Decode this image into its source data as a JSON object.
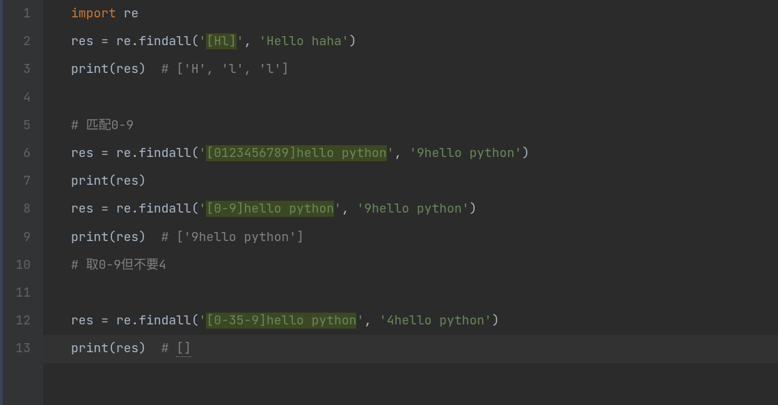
{
  "gutter": [
    "1",
    "2",
    "3",
    "4",
    "5",
    "6",
    "7",
    "8",
    "9",
    "10",
    "11",
    "12",
    "13"
  ],
  "code": {
    "l1": {
      "import": "import",
      "mod": " re"
    },
    "l2": {
      "a": "res ",
      "b": "=",
      "c": " re.findall(",
      "d": "'",
      "e": "[Hl]",
      "f": "'",
      "g": ", ",
      "h": "'Hello haha'",
      "i": ")"
    },
    "l3": {
      "a": "print",
      "b": "(res)  ",
      "c": "# ['H', 'l', 'l']"
    },
    "l5": {
      "c": "# 匹配0-9"
    },
    "l6": {
      "a": "res ",
      "b": "=",
      "c": " re.findall(",
      "d": "'",
      "e": "[0123456789]hello python",
      "f": "'",
      "g": ", ",
      "h": "'9hello python'",
      "i": ")"
    },
    "l7": {
      "a": "print",
      "b": "(res)"
    },
    "l8": {
      "a": "res ",
      "b": "=",
      "c": " re.findall(",
      "d": "'",
      "e": "[0-9]hello python",
      "f": "'",
      "g": ", ",
      "h": "'9hello python'",
      "i": ")"
    },
    "l9": {
      "a": "print",
      "b": "(res)  ",
      "c": "# ['9hello python']"
    },
    "l10": {
      "c": "# 取0-9但不要4"
    },
    "l12": {
      "a": "res ",
      "b": "=",
      "c": " re.findall(",
      "d": "'",
      "e": "[0-35-9]hello python",
      "f": "'",
      "g": ", ",
      "h": "'4hello python'",
      "i": ")"
    },
    "l13": {
      "a": "print",
      "b": "(res)  ",
      "c1": "# ",
      "c2": "[]"
    }
  }
}
